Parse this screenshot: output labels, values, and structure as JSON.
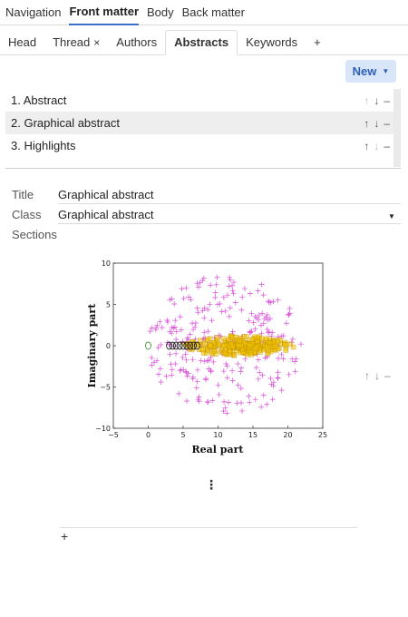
{
  "topnav": {
    "tabs": [
      "Navigation",
      "Front matter",
      "Body",
      "Back matter"
    ],
    "active": 1
  },
  "subtabs": {
    "head": "Head",
    "thread": "Thread",
    "thread_close": "×",
    "authors": "Authors",
    "abstracts": "Abstracts",
    "keywords": "Keywords",
    "add": "+"
  },
  "toolbar": {
    "new_label": "New",
    "new_caret": "▼"
  },
  "abstracts": [
    {
      "label": "1. Abstract"
    },
    {
      "label": "2. Graphical abstract"
    },
    {
      "label": "3. Highlights"
    }
  ],
  "row_controls": {
    "up": "↑",
    "down": "↓",
    "remove": "–"
  },
  "form": {
    "title_label": "Title",
    "title_value": "Graphical abstract",
    "class_label": "Class",
    "class_value": "Graphical abstract",
    "sections_label": "Sections",
    "select_caret": "▼"
  },
  "section_controls": {
    "up": "↑",
    "down": "↓",
    "remove": "–"
  },
  "kebab": "⋮",
  "add_section": "+",
  "chart_data": {
    "type": "scatter",
    "xlabel": "Real part",
    "ylabel": "Imaginary part",
    "xlim": [
      -5,
      25
    ],
    "ylim": [
      -10,
      10
    ],
    "xticks": [
      "−5",
      "0",
      "5",
      "10",
      "15",
      "20",
      "25"
    ],
    "yticks": [
      "10",
      "5",
      "0",
      "−5",
      "−10"
    ],
    "colors": {
      "magenta": "#d94fd9",
      "yellow": "#f2c200",
      "green": "#4a9a3a",
      "black": "#222222"
    },
    "series": [
      {
        "marker": "plus",
        "color": "magenta",
        "region": {
          "cx": 11,
          "cy": 0,
          "rx": 11,
          "ry": 8.5
        }
      },
      {
        "marker": "square",
        "color": "yellow",
        "region": {
          "cx": 13,
          "cy": 0,
          "rx": 8,
          "ry": 1.2
        }
      },
      {
        "marker": "circle",
        "color": "black",
        "x": [
          3,
          3.5,
          4,
          4.5,
          5,
          5.5,
          6,
          6.5,
          7
        ],
        "y": [
          0,
          0,
          0,
          0,
          0,
          0,
          0,
          0,
          0
        ]
      },
      {
        "marker": "circle",
        "color": "green",
        "x": [
          0
        ],
        "y": [
          0
        ]
      }
    ]
  }
}
